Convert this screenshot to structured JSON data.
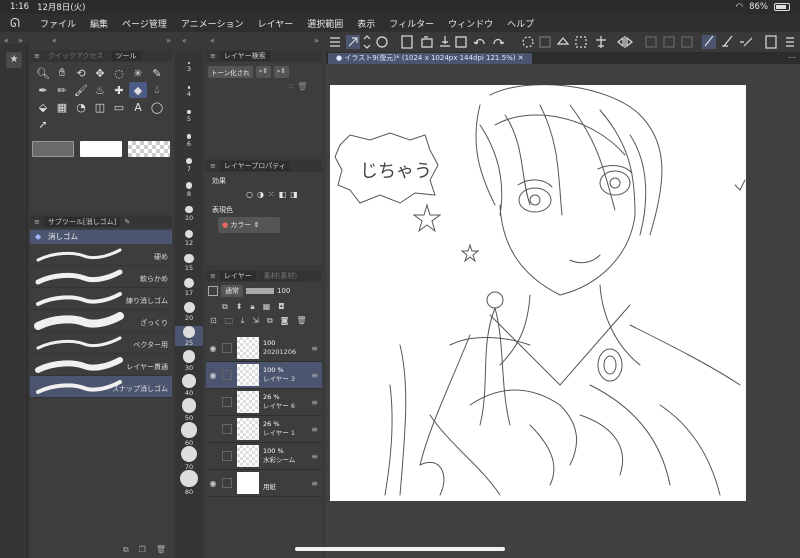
{
  "status": {
    "time": "1:16",
    "date": "12月8日(火)",
    "battery": "86%",
    "battery_level": 0.86
  },
  "menu": [
    "ファイル",
    "編集",
    "ページ管理",
    "アニメーション",
    "レイヤー",
    "選択範囲",
    "表示",
    "フィルター",
    "ウィンドウ",
    "ヘルプ"
  ],
  "tool_panel": {
    "tab_quick": "クイックアクセス",
    "tab_tool": "ツール"
  },
  "subtool_panel": {
    "tab": "サブツール[消しゴム]",
    "group": "消しゴム",
    "brushes": [
      "硬め",
      "軟らかめ",
      "練り消しゴム",
      "ざっくり",
      "ベクター用",
      "レイヤー貫通",
      "スナップ消しゴム"
    ]
  },
  "brush_sizes": [
    "3",
    "4",
    "5",
    "6",
    "7",
    "8",
    "10",
    "12",
    "15",
    "17",
    "20",
    "25",
    "30",
    "40",
    "50",
    "60",
    "70",
    "80"
  ],
  "layer_search": {
    "title": "レイヤー検索",
    "filter": "トーン化され"
  },
  "layer_props": {
    "title": "レイヤープロパティ",
    "effect": "効果",
    "color_label": "表現色",
    "color_value": "カラー"
  },
  "layer_panel": {
    "tab": "レイヤー",
    "tab2": "素材(素材)",
    "blend": "通常",
    "opacity": "100",
    "layers": [
      {
        "pct": "100",
        "name": "20201206"
      },
      {
        "pct": "100 %",
        "name": "レイヤー 3"
      },
      {
        "pct": "26 %",
        "name": "レイヤー 6"
      },
      {
        "pct": "26 %",
        "name": "レイヤー 1"
      },
      {
        "pct": "100 %",
        "name": "水彩シーム"
      },
      {
        "pct": "",
        "name": "用紙"
      }
    ]
  },
  "canvas": {
    "doc_tab": "イラスト9(復元)* (1024 x 1024px 144dpi 121.5%)",
    "speech": "じちゃう"
  }
}
